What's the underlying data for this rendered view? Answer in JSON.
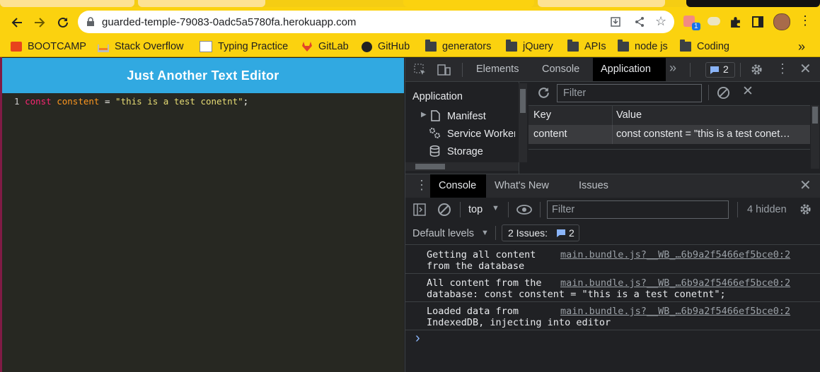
{
  "browser": {
    "url": "guarded-temple-79083-0adc5a5780fa.herokuapp.com",
    "extension_badge": "1",
    "bookmarks": [
      {
        "label": "BOOTCAMP",
        "icon": "bootcamp-icon"
      },
      {
        "label": "Stack Overflow",
        "icon": "stackoverflow-icon"
      },
      {
        "label": "Typing Practice",
        "icon": "typing-icon"
      },
      {
        "label": "GitLab",
        "icon": "gitlab-icon"
      },
      {
        "label": "GitHub",
        "icon": "github-icon"
      },
      {
        "label": "generators",
        "icon": "folder-icon"
      },
      {
        "label": "jQuery",
        "icon": "folder-icon"
      },
      {
        "label": "APIs",
        "icon": "folder-icon"
      },
      {
        "label": "node js",
        "icon": "folder-icon"
      },
      {
        "label": "Coding",
        "icon": "folder-icon"
      }
    ],
    "more_bookmarks": "»"
  },
  "app": {
    "title": "Just Another Text Editor",
    "line_number": "1",
    "code": {
      "keyword": "const",
      "variable": "constent",
      "operator": "=",
      "string": "\"this is a test conetnt\"",
      "end": ";"
    }
  },
  "devtools": {
    "tabs": [
      "Elements",
      "Console",
      "Application"
    ],
    "active_tab": "Application",
    "issues_count": "2",
    "sidebar": {
      "heading": "Application",
      "items": [
        "Manifest",
        "Service Workers",
        "Storage"
      ]
    },
    "storage": {
      "filter_placeholder": "Filter",
      "columns": [
        "Key",
        "Value"
      ],
      "rows": [
        {
          "key": "content",
          "value": "const constent = \"this is a test conet…"
        }
      ]
    },
    "drawer": {
      "tabs": [
        "Console",
        "What's New",
        "Issues"
      ],
      "context": "top",
      "filter_placeholder": "Filter",
      "hidden": "4 hidden",
      "levels": "Default levels",
      "issues_label": "2 Issues:",
      "issues_count": "2",
      "messages": [
        {
          "text1": "Getting all content",
          "text2": "from the database",
          "source": "main.bundle.js?__WB_…6b9a2f5466ef5bce0:2"
        },
        {
          "text1": "All content from the",
          "text2": "database: const constent = \"this is a test conetnt\";",
          "source": "main.bundle.js?__WB_…6b9a2f5466ef5bce0:2"
        },
        {
          "text1": "Loaded data from",
          "text2": "IndexedDB, injecting into editor",
          "source": "main.bundle.js?__WB_…6b9a2f5466ef5bce0:2"
        }
      ],
      "prompt": "›"
    }
  },
  "colors": {
    "chrome_yellow": "#fbd20f",
    "app_header": "#31a9e1",
    "editor_bg": "#272822",
    "keyword": "#f92672",
    "variable": "#fd971f",
    "string": "#e6db74",
    "devtools_bg": "#202124",
    "accent_blue": "#8ab4f8"
  }
}
